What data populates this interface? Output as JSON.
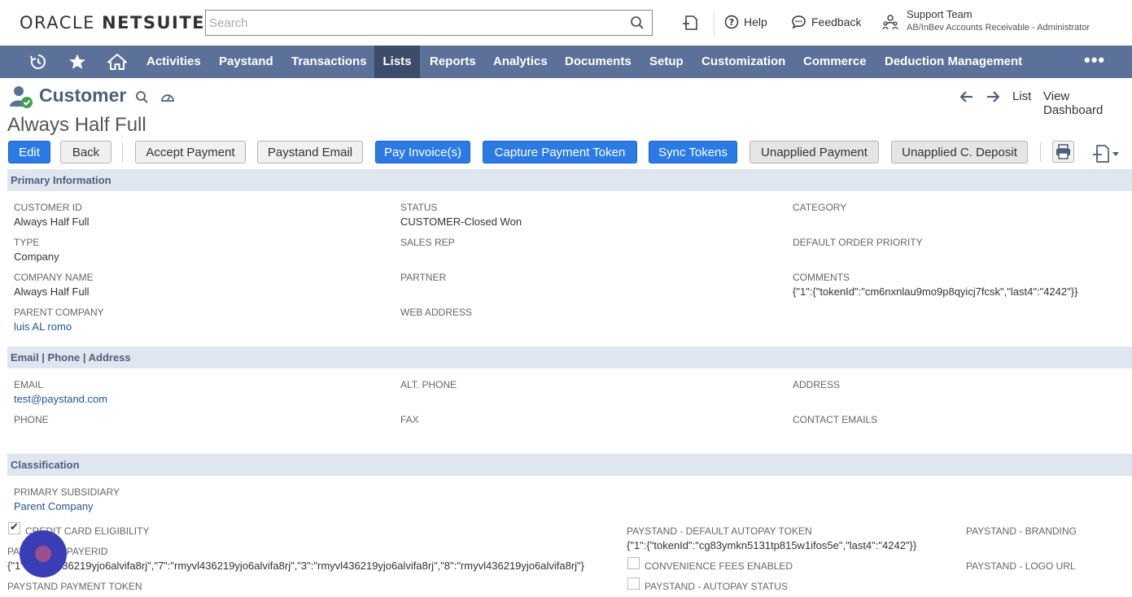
{
  "header": {
    "logo_part1": "ORACLE",
    "logo_part2": "NETSUITE",
    "search_placeholder": "Search",
    "help_label": "Help",
    "feedback_label": "Feedback",
    "role_name": "Support Team",
    "role_sub": "AB/InBev Accounts Receivable - Administrator"
  },
  "nav": {
    "items": [
      "Activities",
      "Paystand",
      "Transactions",
      "Lists",
      "Reports",
      "Analytics",
      "Documents",
      "Setup",
      "Customization",
      "Commerce",
      "Deduction Management"
    ],
    "active": "Lists",
    "more": "•••"
  },
  "page": {
    "title": "Customer",
    "record_name": "Always Half Full",
    "list_link": "List",
    "dashboard_link": "View Dashboard"
  },
  "buttons": {
    "edit": "Edit",
    "back": "Back",
    "accept_payment": "Accept Payment",
    "paystand_email": "Paystand Email",
    "pay_invoices": "Pay Invoice(s)",
    "capture_token": "Capture Payment Token",
    "sync_tokens": "Sync Tokens",
    "unapplied_payment": "Unapplied Payment",
    "unapplied_deposit": "Unapplied C. Deposit"
  },
  "primary": {
    "section": "Primary Information",
    "customer_id_label": "CUSTOMER ID",
    "customer_id": "Always Half Full",
    "status_label": "STATUS",
    "status": "CUSTOMER-Closed Won",
    "category_label": "CATEGORY",
    "type_label": "TYPE",
    "type": "Company",
    "sales_rep_label": "SALES REP",
    "priority_label": "DEFAULT ORDER PRIORITY",
    "company_name_label": "COMPANY NAME",
    "company_name": "Always Half Full",
    "partner_label": "PARTNER",
    "comments_label": "COMMENTS",
    "comments": "{\"1\":{\"tokenId\":\"cm6nxnlau9mo9p8qyicj7fcsk\",\"last4\":\"4242\"}}",
    "parent_company_label": "PARENT COMPANY",
    "parent_company": "luis AL romo",
    "web_address_label": "WEB ADDRESS"
  },
  "contact": {
    "section": "Email | Phone | Address",
    "email_label": "EMAIL",
    "email": "test@paystand.com",
    "alt_phone_label": "ALT. PHONE",
    "address_label": "ADDRESS",
    "phone_label": "PHONE",
    "fax_label": "FAX",
    "contact_emails_label": "CONTACT EMAILS"
  },
  "classification": {
    "section": "Classification",
    "subsidiary_label": "PRIMARY SUBSIDIARY",
    "subsidiary": "Parent Company",
    "cc_eligibility_label": "CREDIT CARD ELIGIBILITY",
    "payerid_label": "PAYSTAND - PAYERID",
    "payerid": "{\"1\":\"rmyvl436219yjo6alvifa8rj\",\"7\":\"rmyvl436219yjo6alvifa8rj\",\"3\":\"rmyvl436219yjo6alvifa8rj\",\"8\":\"rmyvl436219yjo6alvifa8rj\"}",
    "payment_token_label": "PAYSTAND PAYMENT TOKEN",
    "autopay_token_label": "PAYSTAND - DEFAULT AUTOPAY TOKEN",
    "autopay_token": "{\"1\":{\"tokenId\":\"cg83ymkn5131tp815w1ifos5e\",\"last4\":\"4242\"}}",
    "convenience_label": "CONVENIENCE FEES ENABLED",
    "autopay_status_label": "PAYSTAND - AUTOPAY STATUS",
    "branding_label": "PAYSTAND - BRANDING",
    "logo_url_label": "PAYSTAND - LOGO URL"
  },
  "colors": {
    "nav_bg": "#5b7199",
    "nav_active": "#3c4c6a",
    "primary_button": "#2c7be5",
    "section_bg": "#e0e6ef",
    "link": "#255599"
  }
}
